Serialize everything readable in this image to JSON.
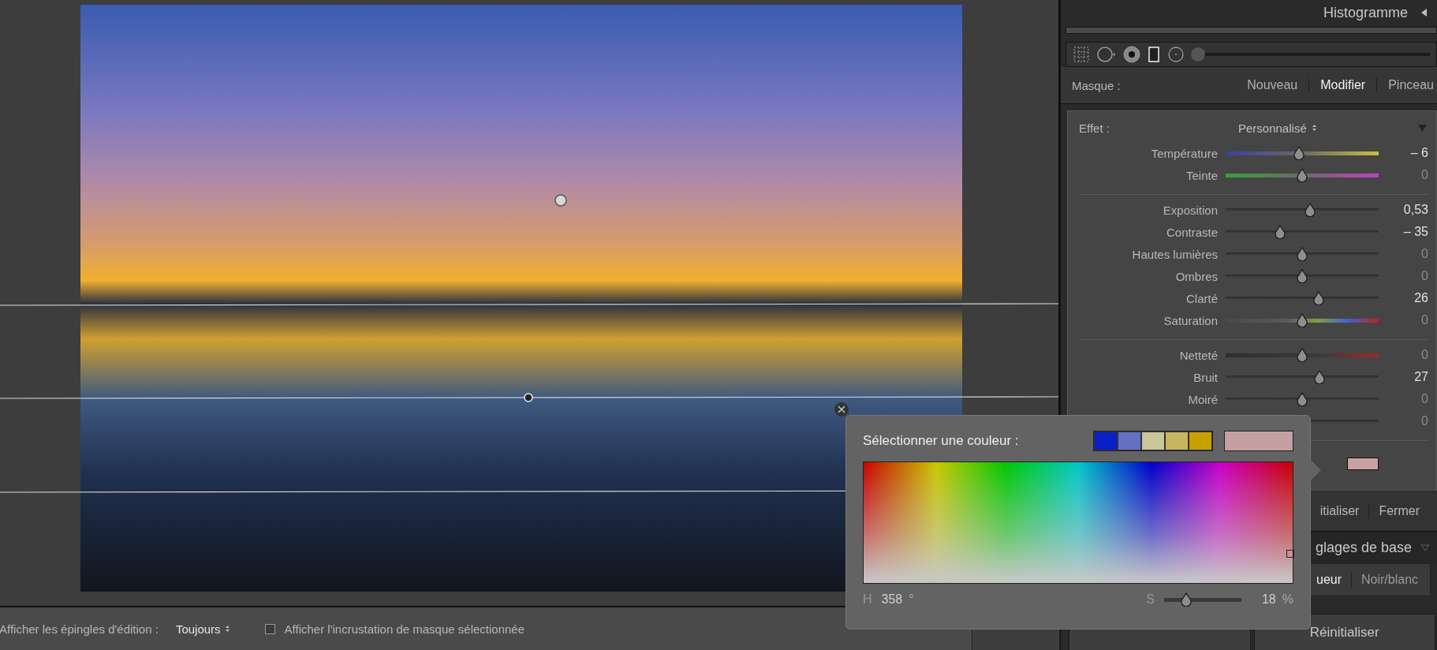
{
  "canvas": {
    "pins": [
      {
        "selected": false
      },
      {
        "selected": true
      }
    ]
  },
  "panel_header": {
    "title": "Histogramme"
  },
  "tools": [
    {
      "kind": "crop",
      "selected": false
    },
    {
      "kind": "spot",
      "selected": false
    },
    {
      "kind": "redeye",
      "selected": false
    },
    {
      "kind": "gradient",
      "selected": true
    },
    {
      "kind": "radial",
      "selected": false
    }
  ],
  "tool_slider": {
    "level": 0
  },
  "mask": {
    "label": "Masque :",
    "tabs": [
      {
        "label": "Nouveau",
        "selected": false
      },
      {
        "label": "Modifier",
        "selected": true
      },
      {
        "label": "Pinceau",
        "selected": false
      }
    ]
  },
  "effect": {
    "label": "Effet :",
    "preset": "Personnalisé"
  },
  "slider_groups": [
    [
      {
        "label": "Température",
        "kind": "temperature",
        "level": 0.476,
        "value": "– 6",
        "modified": true
      },
      {
        "label": "Teinte",
        "kind": "tint",
        "level": 0.5,
        "value": "0",
        "modified": false
      }
    ],
    [
      {
        "label": "Exposition",
        "kind": "plain",
        "level": 0.558,
        "value": "0,53",
        "modified": true
      },
      {
        "label": "Contraste",
        "kind": "plain",
        "level": 0.344,
        "value": "– 35",
        "modified": true
      },
      {
        "label": "Hautes lumières",
        "kind": "plain",
        "level": 0.5,
        "value": "0",
        "modified": false
      },
      {
        "label": "Ombres",
        "kind": "plain",
        "level": 0.5,
        "value": "0",
        "modified": false
      },
      {
        "label": "Clarté",
        "kind": "plain",
        "level": 0.617,
        "value": "26",
        "modified": true
      },
      {
        "label": "Saturation",
        "kind": "saturation",
        "level": 0.5,
        "value": "0",
        "modified": false
      }
    ],
    [
      {
        "label": "Netteté",
        "kind": "sharpness",
        "level": 0.5,
        "value": "0",
        "modified": false
      },
      {
        "label": "Bruit",
        "kind": "plain",
        "level": 0.622,
        "value": "27",
        "modified": true
      },
      {
        "label": "Moiré",
        "kind": "plain",
        "level": 0.5,
        "value": "0",
        "modified": false
      },
      {
        "kind": "plain",
        "level": 0.5,
        "value": "0",
        "modified": false
      }
    ]
  ],
  "color_row": {
    "color": "#c9a1a5"
  },
  "panel_buttons": [
    "itialiser",
    "Fermer"
  ],
  "basic": {
    "title": "glages de base",
    "treatments": [
      {
        "label": "ueur",
        "selected": true
      },
      {
        "label": "Noir/blanc",
        "selected": false
      }
    ]
  },
  "footer_buttons": [
    {
      "kind": "covered"
    },
    {
      "kind": "text",
      "label": "Réinitialiser"
    }
  ],
  "toolbar": {
    "pins_label": "Afficher les épingles d'édition :",
    "pins_value": "Toujours",
    "overlay": {
      "label": "Afficher l'incrustation de masque sélectionnée",
      "checked": false
    },
    "done_button": {
      "kind": "covered"
    }
  },
  "popup": {
    "title": "Sélectionner une couleur :",
    "presets": [
      {
        "color": "#0a1fc8"
      },
      {
        "color": "#6570c0"
      },
      {
        "color": "#cbc59a"
      },
      {
        "color": "#c8b560"
      },
      {
        "color": "#c8a000"
      }
    ],
    "current": {
      "color": "#c4a0a3"
    },
    "h_label": "H",
    "h_value": "358",
    "h_unit": "°",
    "s_label": "S",
    "s_slider": {
      "level": 0.24
    },
    "s_value": "18",
    "s_unit": "%"
  }
}
